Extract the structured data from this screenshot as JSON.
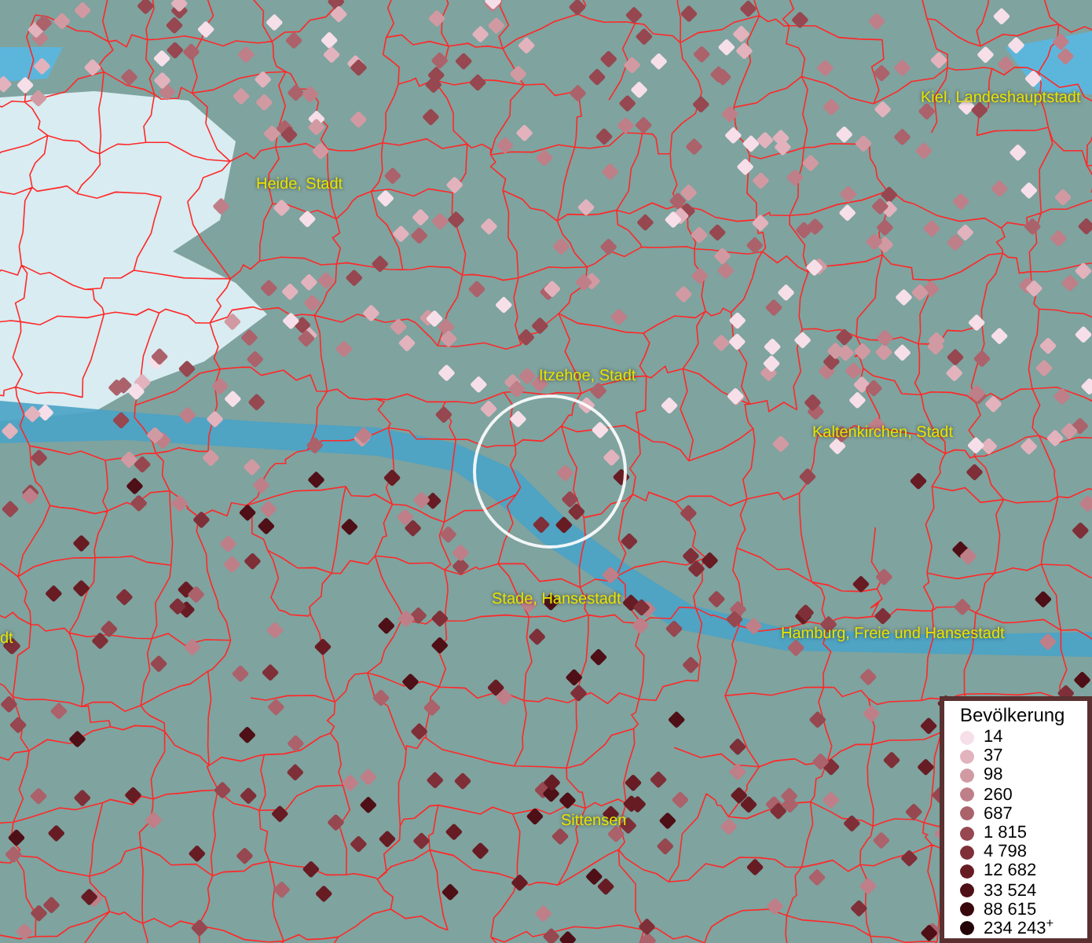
{
  "map": {
    "place_labels": [
      {
        "text": "Kiel, Landeshauptstadt"
      },
      {
        "text": "Heide, Stadt"
      },
      {
        "text": "Itzehoe, Stadt"
      },
      {
        "text": "Kaltenkirchen, Stadt"
      },
      {
        "text": "Stade, Hansestadt"
      },
      {
        "text": "dt"
      },
      {
        "text": "Hamburg, Freie und Hansestadt"
      },
      {
        "text": "Sittensen"
      }
    ]
  },
  "legend": {
    "title": "Bevölkerung",
    "items": [
      {
        "label": "14",
        "color": "#f6dfe8"
      },
      {
        "label": "37",
        "color": "#e2b3bd"
      },
      {
        "label": "98",
        "color": "#d19aa2"
      },
      {
        "label": "260",
        "color": "#bf7f88"
      },
      {
        "label": "687",
        "color": "#ab626b"
      },
      {
        "label": "1 815",
        "color": "#96474f"
      },
      {
        "label": "4 798",
        "color": "#7f2f38"
      },
      {
        "label": "12 682",
        "color": "#671c24"
      },
      {
        "label": "33 524",
        "color": "#4f0f16"
      },
      {
        "label": "88 615",
        "color": "#38070c"
      },
      {
        "label": "234 243$^{+}$",
        "color": "#240306"
      }
    ]
  }
}
